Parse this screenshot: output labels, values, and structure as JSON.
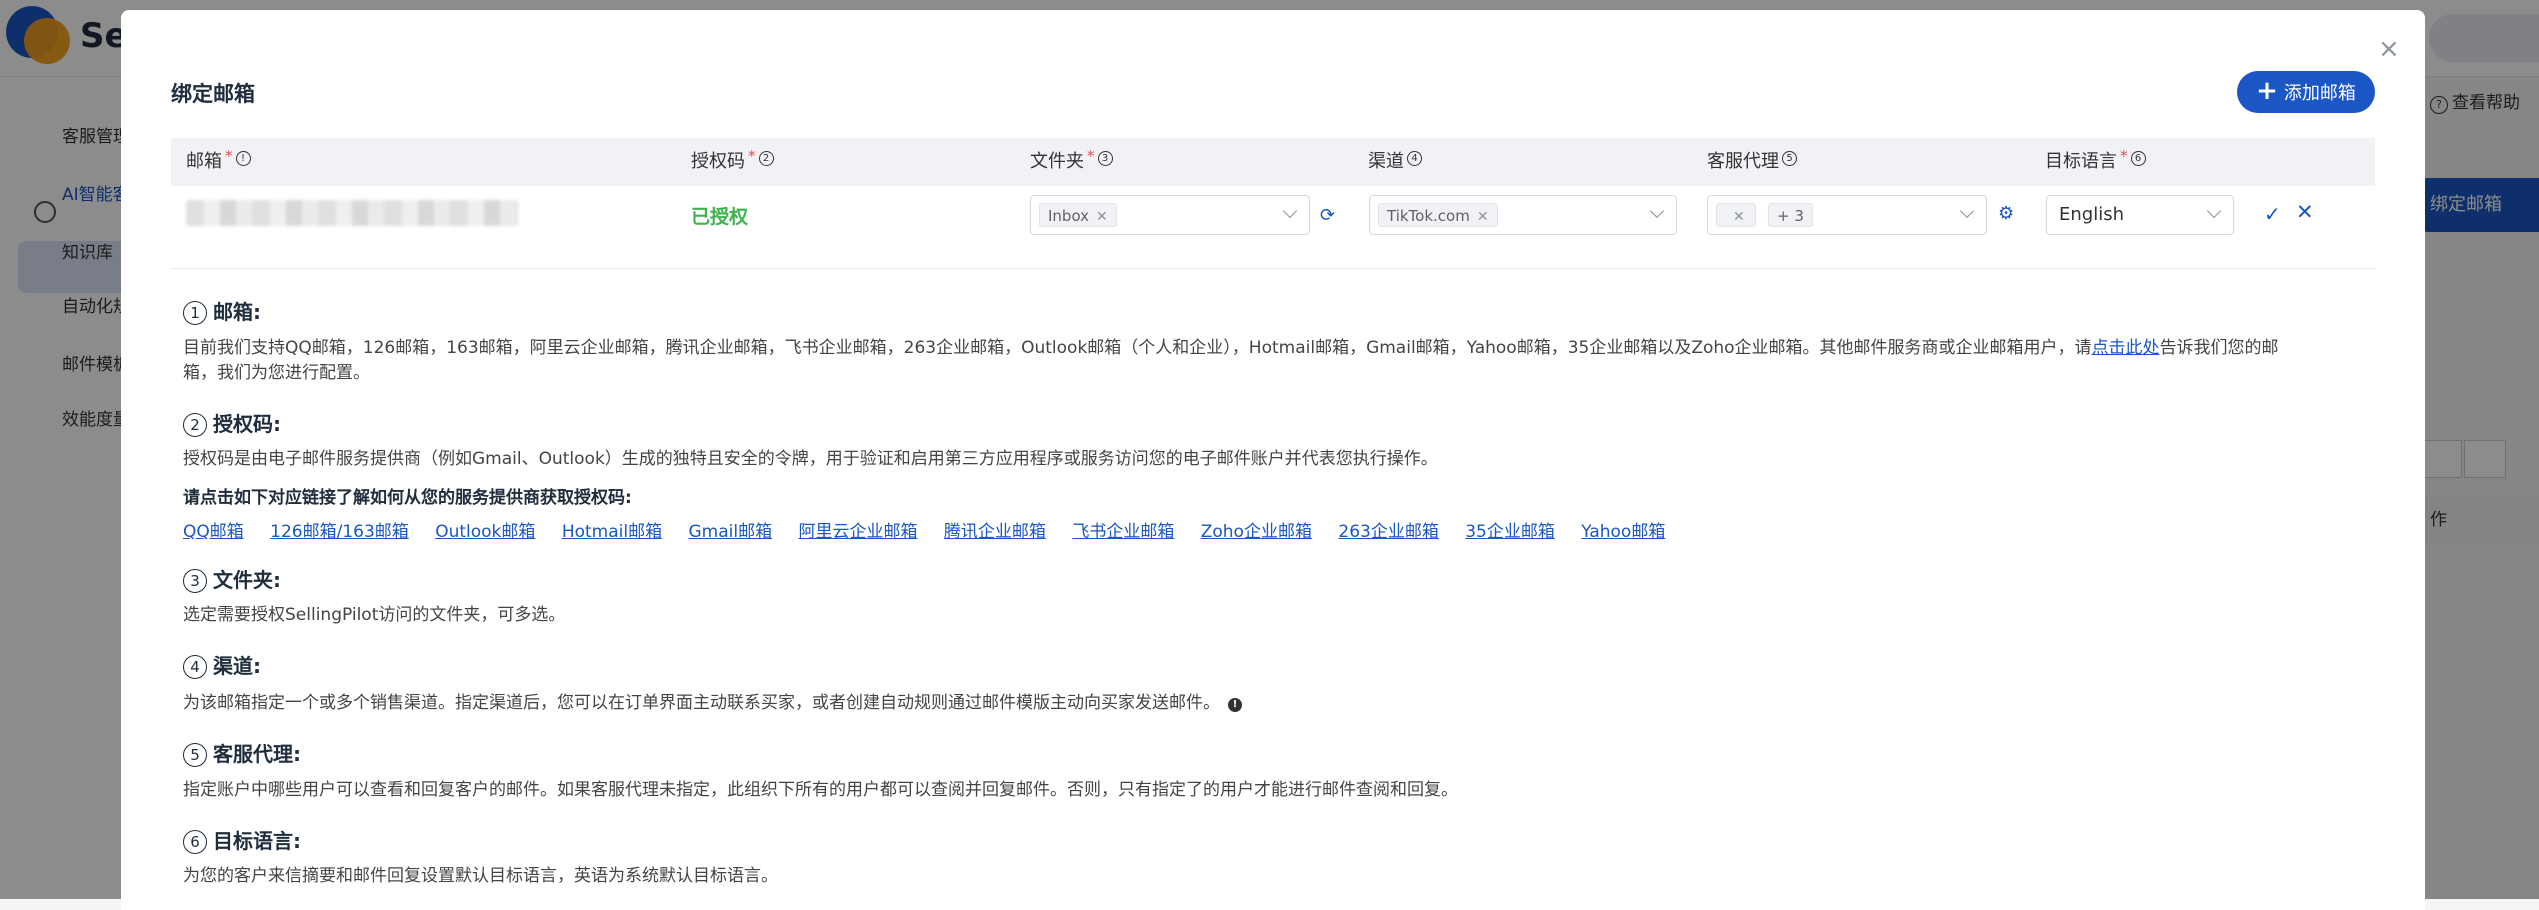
{
  "background": {
    "logo_text": "Se",
    "sidebar": {
      "section": "客服管理",
      "items": [
        "AI智能客",
        "知识库",
        "自动化规",
        "邮件模板",
        "效能度量"
      ]
    },
    "help_text": "查看帮助",
    "primary_button": "绑定邮箱",
    "column_label": "作"
  },
  "modal": {
    "title": "绑定邮箱",
    "add_button": "添加邮箱",
    "columns": [
      {
        "label": "邮箱",
        "required": "*",
        "help": "!"
      },
      {
        "label": "授权码",
        "required": "*",
        "help": "2"
      },
      {
        "label": "文件夹",
        "required": "*",
        "help": "3"
      },
      {
        "label": "渠道",
        "required": "",
        "help": "4"
      },
      {
        "label": "客服代理",
        "required": "",
        "help": "5"
      },
      {
        "label": "目标语言",
        "required": "*",
        "help": "6"
      }
    ],
    "row": {
      "auth_status": "已授权",
      "folder_tag": "Inbox",
      "channel_tag": "TikTok.com",
      "agent_more": "+ 3",
      "language": "English"
    }
  },
  "help_sections": [
    {
      "num": "1",
      "title": "邮箱:",
      "text1_before": "目前我们支持QQ邮箱，126邮箱，163邮箱，阿里云企业邮箱，腾讯企业邮箱，飞书企业邮箱，263企业邮箱，Outlook邮箱（个人和企业），Hotmail邮箱，Gmail邮箱，Yahoo邮箱，35企业邮箱以及Zoho企业邮箱。其他邮件服务商或企业邮箱用户，请",
      "text1_link": "点击此处",
      "text1_after": "告诉我们您的邮",
      "text2": "箱，我们为您进行配置。"
    },
    {
      "num": "2",
      "title": "授权码:",
      "text": "授权码是由电子邮件服务提供商（例如Gmail、Outlook）生成的独特且安全的令牌，用于验证和启用第三方应用程序或服务访问您的电子邮件账户并代表您执行操作。",
      "bold": "请点击如下对应链接了解如何从您的服务提供商获取授权码:",
      "links": [
        "QQ邮箱",
        "126邮箱/163邮箱",
        "Outlook邮箱",
        "Hotmail邮箱",
        "Gmail邮箱",
        "阿里云企业邮箱",
        "腾讯企业邮箱",
        "飞书企业邮箱",
        "Zoho企业邮箱",
        "263企业邮箱",
        "35企业邮箱",
        "Yahoo邮箱"
      ]
    },
    {
      "num": "3",
      "title": "文件夹:",
      "text": "选定需要授权SellingPilot访问的文件夹，可多选。"
    },
    {
      "num": "4",
      "title": "渠道:",
      "text": "为该邮箱指定一个或多个销售渠道。指定渠道后，您可以在订单界面主动联系买家，或者创建自动规则通过邮件模版主动向买家发送邮件。",
      "info": "!"
    },
    {
      "num": "5",
      "title": "客服代理:",
      "text": "指定账户中哪些用户可以查看和回复客户的邮件。如果客服代理未指定，此组织下所有的用户都可以查阅并回复邮件。否则，只有指定了的用户才能进行邮件查阅和回复。"
    },
    {
      "num": "6",
      "title": "目标语言:",
      "text": "为您的客户来信摘要和邮件回复设置默认目标语言，英语为系统默认目标语言。"
    }
  ],
  "colors": {
    "primary": "#1a56c4",
    "success": "#3fb34f",
    "required": "#e5484d"
  }
}
